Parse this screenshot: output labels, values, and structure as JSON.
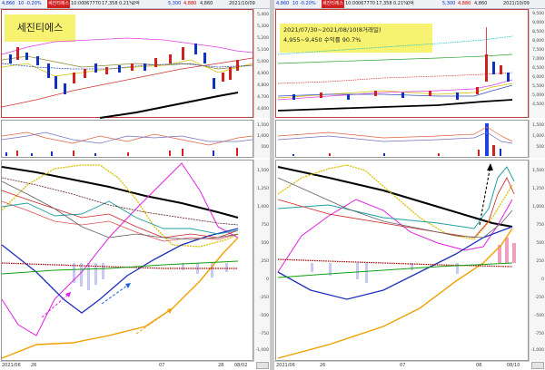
{
  "left": {
    "toolbar": {
      "price": "4,860",
      "change": "10 -0.20%",
      "flag": "세진티에스",
      "time": "10:00",
      "code": "067770",
      "volume": "17,358",
      "rate": "0.21%",
      "exchange": "0억",
      "high": "5,300",
      "low": "4,880",
      "open": "4,860",
      "date": "2021/10/09"
    },
    "title": "세진티에스",
    "price_axis": [
      "5,400",
      "5,300",
      "5,200",
      "5,100",
      "5,000",
      "4,900",
      "4,800",
      "4,700",
      "4,600"
    ],
    "vol_axis": [
      "1,500",
      "1,000",
      "500"
    ],
    "osc_axis": [
      "1,500",
      "1,250",
      "1,000",
      "750",
      "500",
      "250",
      "0",
      "-250",
      "-500",
      "-750",
      "-1,000"
    ],
    "dates": [
      "2021/06",
      "26",
      "07",
      "28",
      "08/02"
    ]
  },
  "right": {
    "toolbar": {
      "price": "4,860",
      "change": "10 -0.20%",
      "flag": "세진티에스",
      "time": "10:00",
      "code": "067770",
      "volume": "17,358",
      "rate": "0.21%",
      "exchange": "0억",
      "high": "5,300",
      "low": "4,880",
      "open": "4,860",
      "date": "2021/10/09"
    },
    "annotation_line1": "2021/07/30~2021/08/10(8거래일)",
    "annotation_line2": "4,955~9,450 수익률 90.7%",
    "price_axis": [
      "9,500",
      "9,000",
      "8,500",
      "8,000",
      "7,500",
      "7,000",
      "6,500",
      "6,000",
      "5,500",
      "5,000",
      "4,500"
    ],
    "vol_axis": [
      "1,500",
      "1,000",
      "500"
    ],
    "osc_axis": [
      "1,500",
      "1,250",
      "1,000",
      "750",
      "500",
      "250",
      "0",
      "-250",
      "-500",
      "-750",
      "-1,000"
    ],
    "dates": [
      "2021/06",
      "26",
      "07",
      "08",
      "08/10"
    ]
  }
}
